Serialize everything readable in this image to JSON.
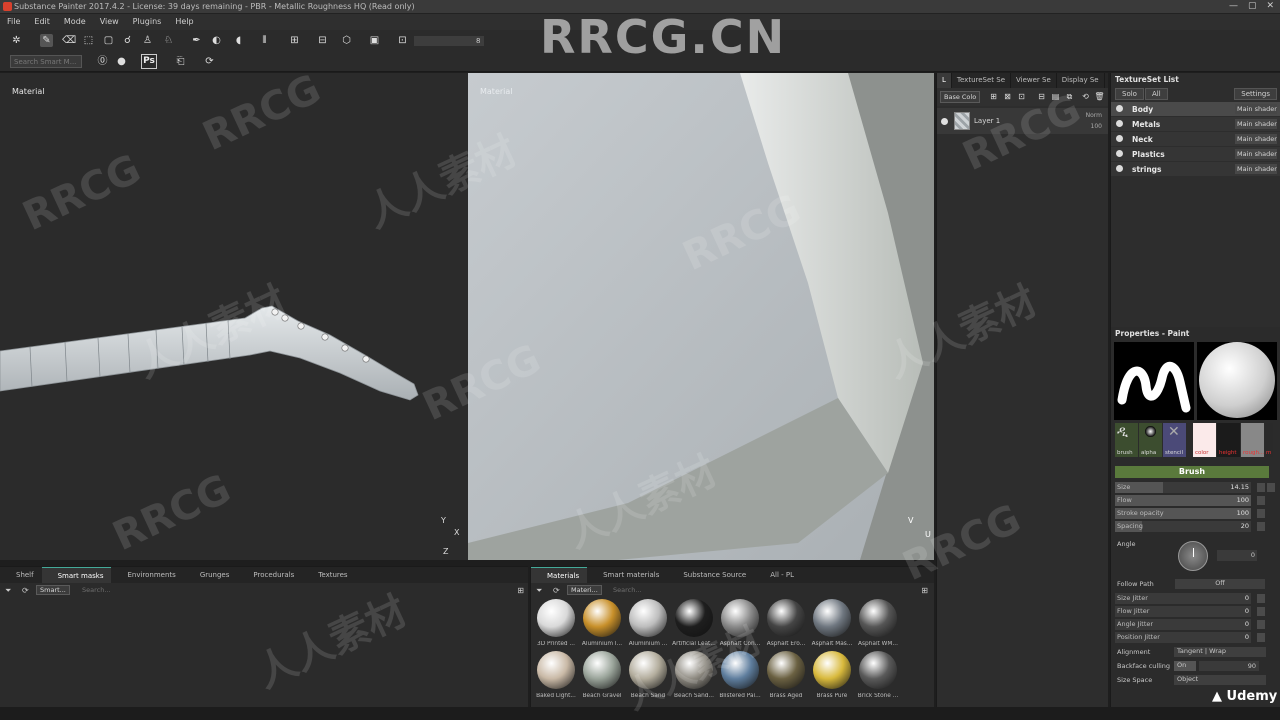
{
  "window": {
    "title": "Substance Painter 2017.4.2 - License: 39 days remaining - PBR - Metallic Roughness HQ (Read only)",
    "controls": [
      "—",
      "▢",
      "✕"
    ]
  },
  "menu": [
    "File",
    "Edit",
    "Mode",
    "View",
    "Plugins",
    "Help"
  ],
  "toolbar": {
    "smart_search_placeholder": "Search Smart M...",
    "ps_label": "Ps",
    "slider_value": "8"
  },
  "viewport3d": {
    "label": "Material",
    "axes": [
      "Y",
      "X",
      "Z"
    ]
  },
  "viewport2d": {
    "label": "Material",
    "axes": [
      "V",
      "U"
    ]
  },
  "layers": {
    "tabs": [
      "L",
      "TextureSet Se",
      "Viewer Se",
      "Display Se"
    ],
    "channel_select": "Base Colo",
    "layer": {
      "name": "Layer 1",
      "blend": "Norm",
      "opacity": "100"
    }
  },
  "texture_set_list": {
    "title": "TextureSet List",
    "buttons": [
      "Solo",
      "All",
      "Settings"
    ],
    "sets": [
      {
        "name": "Body",
        "shader": "Main shader"
      },
      {
        "name": "Metals",
        "shader": "Main shader"
      },
      {
        "name": "Neck",
        "shader": "Main shader"
      },
      {
        "name": "Plastics",
        "shader": "Main shader"
      },
      {
        "name": "strings",
        "shader": "Main shader"
      }
    ]
  },
  "properties": {
    "title": "Properties - Paint",
    "thumbs": [
      "brush",
      "alpha",
      "stencil",
      "color",
      "height",
      "rough...",
      "m"
    ],
    "section": "Brush",
    "rows": [
      {
        "label": "Size",
        "value": "14.15",
        "fill": 0.35
      },
      {
        "label": "Flow",
        "value": "100",
        "fill": 1.0
      },
      {
        "label": "Stroke opacity",
        "value": "100",
        "fill": 1.0
      },
      {
        "label": "Spacing",
        "value": "20",
        "fill": 0.2
      }
    ],
    "angle_label": "Angle",
    "angle_value": "0",
    "follow_path_label": "Follow Path",
    "follow_path_value": "Off",
    "jitters": [
      {
        "label": "Size Jitter",
        "value": "0"
      },
      {
        "label": "Flow Jitter",
        "value": "0"
      },
      {
        "label": "Angle Jitter",
        "value": "0"
      },
      {
        "label": "Position Jitter",
        "value": "0"
      }
    ],
    "alignment_label": "Alignment",
    "alignment_value": "Tangent | Wrap",
    "backface_label": "Backface culling",
    "backface_toggle": "On",
    "backface_value": "90",
    "size_space_label": "Size Space",
    "size_space_value": "Object"
  },
  "shelf": {
    "tabs": [
      "Shelf",
      "Smart masks",
      "Environments",
      "Grunges",
      "Procedurals",
      "Textures"
    ],
    "filter_chip": "Smart...",
    "search_placeholder": "Search..."
  },
  "materials": {
    "tabs": [
      "Materials",
      "Smart materials",
      "Substance Source",
      "All - PL"
    ],
    "filter_chip": "Materi...",
    "search_placeholder": "Search...",
    "items": [
      {
        "label": "3D Printed ...",
        "color": "#d9d9d9"
      },
      {
        "label": "Aluminium I...",
        "color": "#c8902a"
      },
      {
        "label": "Aluminium ...",
        "color": "#bdbdbd"
      },
      {
        "label": "Artificial Leat...",
        "color": "#1e1e1e"
      },
      {
        "label": "Asphalt Con...",
        "color": "#8a8a8a"
      },
      {
        "label": "Asphalt Ero...",
        "color": "#454545"
      },
      {
        "label": "Asphalt Mas...",
        "color": "#6f7780"
      },
      {
        "label": "Asphalt WM...",
        "color": "#565656"
      },
      {
        "label": "Baked Light...",
        "color": "#c9b9a6"
      },
      {
        "label": "Beach Gravel",
        "color": "#9aa49a"
      },
      {
        "label": "Beach Sand",
        "color": "#b3ad9d"
      },
      {
        "label": "Beach Sand...",
        "color": "#8f8b82"
      },
      {
        "label": "Blistered Pai...",
        "color": "#5f7e9e"
      },
      {
        "label": "Brass Aged",
        "color": "#6b6142"
      },
      {
        "label": "Brass Pure",
        "color": "#d8b93c"
      },
      {
        "label": "Brick Stone ...",
        "color": "#5a5a5a"
      }
    ]
  },
  "watermarks": {
    "brand": "RRCG.CN",
    "mark": "RRCG",
    "cn": "人人素材",
    "udemy": "Udemy"
  },
  "colors": {
    "accent_green": "#6aa04a",
    "brush_section": "#5a7a3c"
  }
}
